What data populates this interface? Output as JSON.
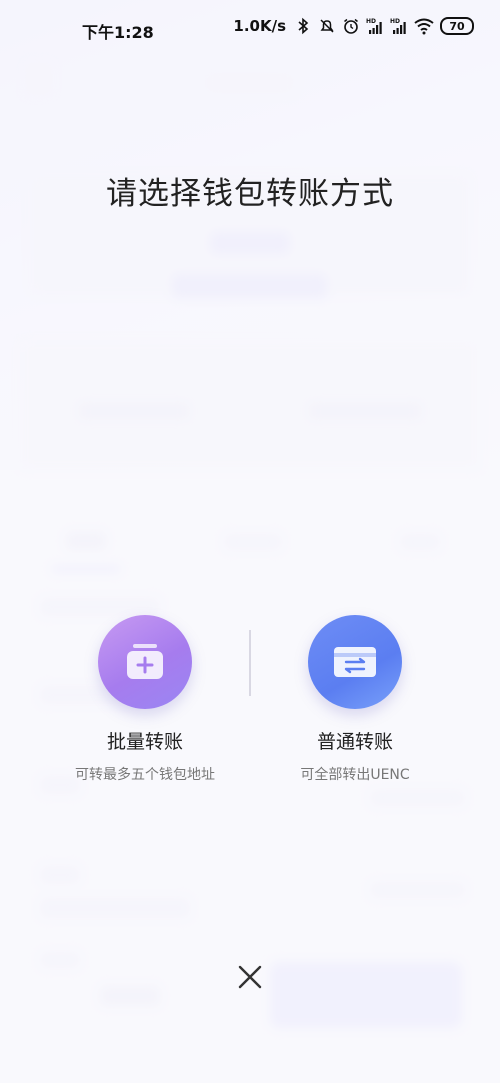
{
  "status_bar": {
    "time": "下午1:28",
    "speed": "1.0K/s",
    "battery": "70"
  },
  "dialog": {
    "title": "请选择钱包转账方式",
    "options": [
      {
        "label": "批量转账",
        "desc": "可转最多五个钱包地址",
        "icon": "wallet-plus-icon",
        "color": "#a67cee"
      },
      {
        "label": "普通转账",
        "desc": "可全部转出UENC",
        "icon": "card-swap-icon",
        "color": "#5b7ef1"
      }
    ],
    "close_icon": "close-icon"
  }
}
